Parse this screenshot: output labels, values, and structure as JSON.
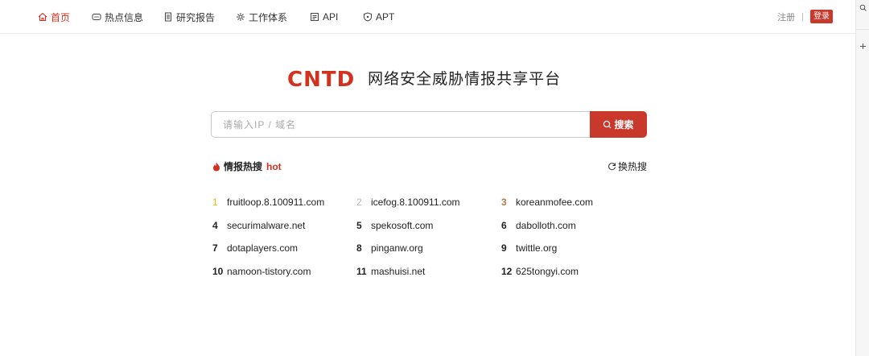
{
  "nav": {
    "items": [
      {
        "label": "首页",
        "icon": "home-icon",
        "active": true
      },
      {
        "label": "热点信息",
        "icon": "message-icon",
        "active": false
      },
      {
        "label": "研究报告",
        "icon": "document-icon",
        "active": false
      },
      {
        "label": "工作体系",
        "icon": "gear-cluster-icon",
        "active": false
      },
      {
        "label": "API",
        "icon": "api-doc-icon",
        "active": false
      },
      {
        "label": "APT",
        "icon": "shield-icon",
        "active": false
      }
    ],
    "register_label": "注册",
    "separator": "|",
    "login_label": "登录"
  },
  "brand": {
    "logo_text": "CNTD",
    "title": "网络安全威胁情报共享平台"
  },
  "search": {
    "placeholder": "请输入IP / 域名",
    "value": "",
    "button_label": "搜索"
  },
  "hot": {
    "title": "情报热搜",
    "hot_tag": "hot",
    "refresh_label": "换热搜",
    "items": [
      {
        "rank": "1",
        "domain": "fruitloop.8.100911.com"
      },
      {
        "rank": "2",
        "domain": "icefog.8.100911.com"
      },
      {
        "rank": "3",
        "domain": "koreanmofee.com"
      },
      {
        "rank": "4",
        "domain": "securimalware.net"
      },
      {
        "rank": "5",
        "domain": "spekosoft.com"
      },
      {
        "rank": "6",
        "domain": "dabolloth.com"
      },
      {
        "rank": "7",
        "domain": "dotaplayers.com"
      },
      {
        "rank": "8",
        "domain": "pinganw.org"
      },
      {
        "rank": "9",
        "domain": "twittle.org"
      },
      {
        "rank": "10",
        "domain": "namoon-tistory.com"
      },
      {
        "rank": "11",
        "domain": "mashuisi.net"
      },
      {
        "rank": "12",
        "domain": "625tongyi.com"
      }
    ]
  },
  "colors": {
    "brand_red": "#d2311e",
    "button_red": "#c9392b",
    "rank1": "#f2b705",
    "rank2": "#b8b8b8",
    "rank3": "#b8773c"
  }
}
